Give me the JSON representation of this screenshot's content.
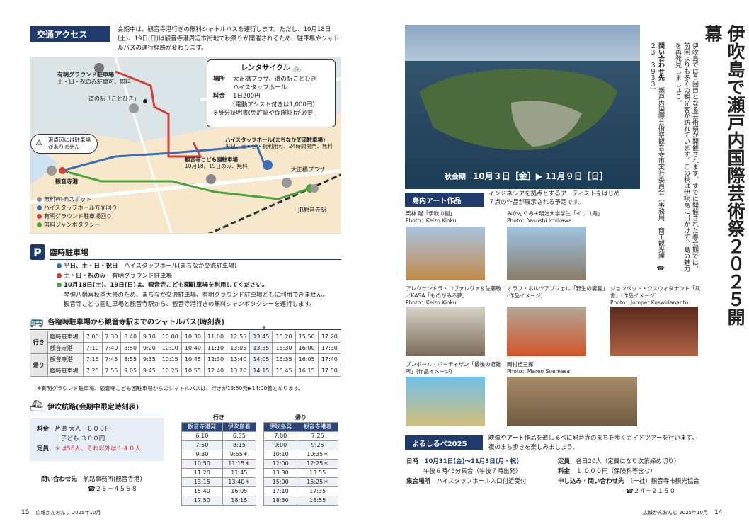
{
  "left_page": {
    "access": {
      "title": "交通アクセス",
      "intro": "会期中は、観音寺港行きの無料シャトルバスを運行します。ただし、10月18日(土)、19日(日)は観音寺港周辺市街地で秋祭りが開催されるため、駐車場やシャトルバスの運行経路が変わります。",
      "map_labels": {
        "yushu_parking": "有明グラウンド駐車場",
        "yushu_parking_note": "土・日・祝のみ駐車可、無料",
        "michi_no_eki": "道の駅「ことひき」",
        "no_parking_warning": "港周辺には駐車場がありません",
        "port": "観音寺港",
        "hightap": "ハイスタッフホール(まちなか交流駐車場)",
        "hightap_note": "平日、土・日・祝利用可、24時間開門、無料",
        "kodomo": "観音寺こども園駐車場",
        "kodomo_note": "10月18、19日のみ、無料",
        "ohashi": "大正橋プラザ",
        "jr": "JR観音寺駅"
      },
      "rental": {
        "title": "レンタサイクル",
        "place_label": "場所",
        "place_value": "大正橋プラザ、道の駅ことひき\nハイスタッフホール",
        "fee_label": "料金",
        "fee_value": "1日200円\n(電動アシスト付きは1,000円)",
        "note": "※身分証明書(免許証や保険証)が必要"
      },
      "legend": [
        {
          "label": "無料Wi-Fiスポット",
          "color": "#888888"
        },
        {
          "label": "ハイスタッフホール方面回り",
          "color": "#3a6db5"
        },
        {
          "label": "有明グラウンド駐車場回り",
          "color": "#d0413b"
        },
        {
          "label": "無料ジャンボタクシー",
          "color": "#4aa43c"
        }
      ]
    },
    "parking": {
      "badge": "P",
      "title": "臨時駐車場",
      "line1_prefix": "平日、土・日・祝日",
      "line1": "ハイスタッフホール(まちなか交流駐車場)",
      "line2_prefix": "土・日・祝のみ",
      "line2": "有明グラウンド駐車場",
      "line3": "10月18日(土)、19日(日)は、観音寺こども園駐車場を利用してください。",
      "line4": "琴弾八幡宮秋季大祭のため、まちなか交流駐車場、有明グラウンド駐車場ともに利用できません。",
      "line5": "観音寺こども園駐車場と観音寺駅から、観音寺港行きの無料ジャンボタクシーを運行します。"
    },
    "shuttle": {
      "title": "各臨時駐車場から観音寺駅までのシャトルバス(時刻表)",
      "mark": "※",
      "go_label": "行き",
      "back_label": "帰り",
      "rows": [
        {
          "group": "行き",
          "stop": "臨時駐車場",
          "times": [
            "7:00",
            "7:30",
            "8:40",
            "9:10",
            "10:00",
            "10:30",
            "11:00",
            "12:55",
            "13:45",
            "15:20",
            "15:50",
            "17:20"
          ]
        },
        {
          "group": "行き",
          "stop": "観音寺港",
          "times": [
            "7:10",
            "7:40",
            "8:50",
            "9:20",
            "10:10",
            "10:40",
            "11:10",
            "13:05",
            "13:55",
            "15:30",
            "16:00",
            "17:30"
          ]
        },
        {
          "group": "帰り",
          "stop": "観音寺港",
          "times": [
            "7:15",
            "7:45",
            "8:55",
            "9:35",
            "10:15",
            "10:45",
            "12:30",
            "13:40",
            "14:05",
            "15:35",
            "16:05",
            "17:40"
          ]
        },
        {
          "group": "帰り",
          "stop": "臨時駐車場",
          "times": [
            "7:25",
            "7:55",
            "9:05",
            "9:45",
            "10:25",
            "10:55",
            "12:40",
            "13:20",
            "14:15",
            "15:45",
            "16:15",
            "17:50"
          ]
        }
      ],
      "note": "※有明グラウンド駐車場、観音寺こども園駐車場からのシャトルバスは、行きが13:50発▶14:00着となります。"
    },
    "ferry": {
      "title": "伊吹航路(会期中限定時刻表)",
      "fare_label": "料金",
      "fare_adult": "片道 大人　６００円",
      "fare_child": "子ども ３００円",
      "cap_label": "定員",
      "cap_value": "＊は56人、それ以外は１４０人",
      "contact_label": "問い合わせ先",
      "contact_value": "航路事務所(観音寺港)",
      "contact_tel": "☎２５－４５５８",
      "go_title": "行き",
      "back_title": "帰り",
      "go_head": [
        "観音寺港発",
        "伊吹島着"
      ],
      "back_head": [
        "伊吹島発",
        "観音寺港着"
      ],
      "go": [
        [
          "6:10",
          "6:35"
        ],
        [
          "7:50",
          "8:15"
        ],
        [
          "9:30",
          "9:55＊"
        ],
        [
          "10:50",
          "11:15＊"
        ],
        [
          "11:20",
          "11:45"
        ],
        [
          "13:15",
          "13:40＊"
        ],
        [
          "15:40",
          "16:05"
        ],
        [
          "17:50",
          "18:15"
        ]
      ],
      "back": [
        [
          "7:00",
          "7:25"
        ],
        [
          "9:00",
          "9:25"
        ],
        [
          "10:10",
          "10:35＊"
        ],
        [
          "12:00",
          "12:25＊"
        ],
        [
          "13:30",
          "13:55"
        ],
        [
          "15:00",
          "15:25＊"
        ],
        [
          "17:10",
          "17:35"
        ],
        [
          "18:30",
          "18:55"
        ]
      ]
    },
    "footer": {
      "page": "15",
      "pub": "広報かんおんじ 2025年10月"
    }
  },
  "right_page": {
    "title": "伊吹島で瀬戸内国際芸術祭２０２５開幕",
    "body": "伊吹島では５回目となる芸術祭が開催されます。すでに開催された春会期では、前回よりも多くの観光客が訪れています。この秋は伊吹島に出かけて、島の魅力を再発見しましょう。",
    "contact_label": "問い合わせ先",
    "contact_value": "瀬戸内国際芸術祭観音寺市実行委員会（事務局　商工観光課　☎２３－３９３３）",
    "period_label": "秋会期",
    "period": "10月３日［金］▶ 11月９日［日］",
    "art_title": "島内アート作品",
    "art_intro": "インドネシアを拠点とするアーティストをはじめ\n７点の作品が展示される予定です。",
    "works": [
      {
        "name": "栗林 隆「伊吹の樹」",
        "photo": "Photo：Keizo Kioku"
      },
      {
        "name": "みかんぐみ＋明治大学学生「イリコ庵」",
        "photo": "Photo：Yasushi Ichikawa"
      },
      {
        "name": "アレクサンドラ・コヴァレヴァ＆佐藤敬／KASA「ものがみる夢」",
        "photo": "Photo：Keizo Kioku"
      },
      {
        "name": "オラフ・ホルツアプフェル「野生の饗宴」(作品イメージ)",
        "photo": ""
      },
      {
        "name": "ジョンペット・クスウィダナント「灰書」(作品イメージ)",
        "photo": "Photo：Jompet Kuswidananto"
      },
      {
        "name": "ブンポール・ボーティザン「最後の避難所」(作品イメージ)",
        "photo": ""
      },
      {
        "name": "岡村桂三郎",
        "photo": "Photo：Mareo Suemasa"
      }
    ],
    "yoru": {
      "title": "よるしるべ2025",
      "intro": "映像やアート作品を道しるべに観音寺のまちを歩くガイドツアーを行います。夜のまち歩きを楽しみましょう。",
      "date_label": "日時",
      "date_value": "10月31日(金)～11月3日(月・祝)",
      "time_value": "午後６時45分集合（午後７時出発）",
      "meet_label": "集合場所",
      "meet_value": "ハイスタッフホール入口付近受付",
      "cap_label": "定員",
      "cap_value": "各日20人（定員になり次第締め切り）",
      "fee_label": "料金",
      "fee_value": "１,０００円（保険料等含む）",
      "apply_label": "申し込み・問い合わせ先",
      "apply_value": "（一社）観音寺市観光協会",
      "apply_tel": "☎２４－２１５０"
    },
    "footer": {
      "page": "14",
      "pub": "広報かんおんじ 2025年10月"
    }
  }
}
